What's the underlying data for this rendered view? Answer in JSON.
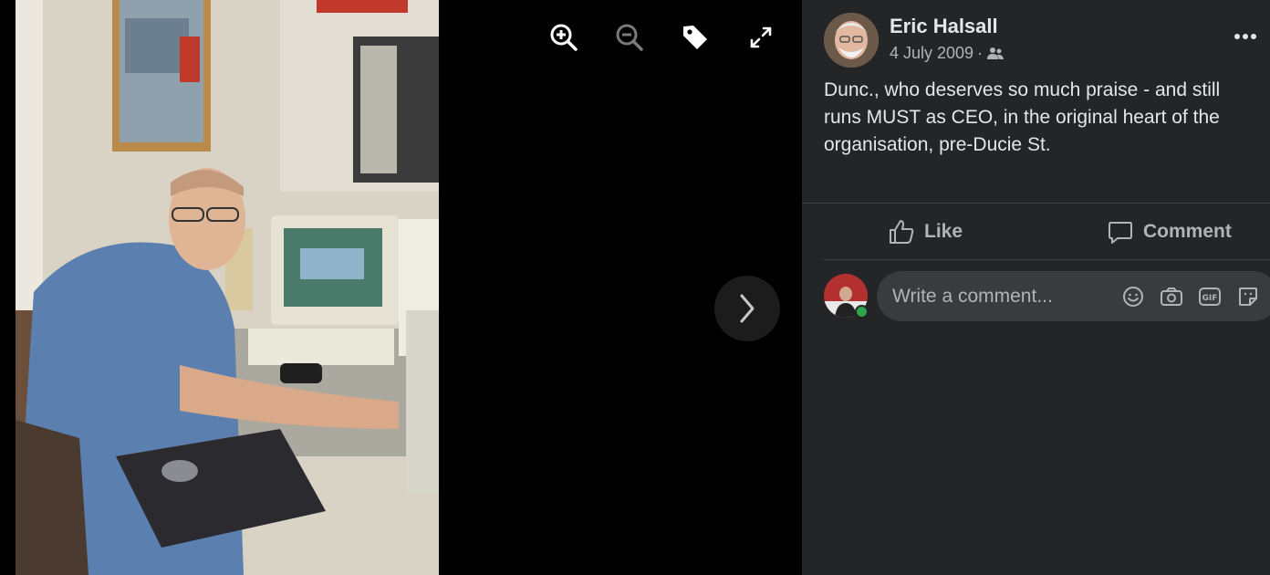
{
  "viewer": {
    "toolbar": {
      "zoom_in": "zoom-in-icon",
      "zoom_out": "zoom-out-icon",
      "tag": "tag-icon",
      "fullscreen": "fullscreen-icon"
    },
    "next": "chevron-right-icon"
  },
  "post": {
    "author": "Eric Halsall",
    "date": "4 July 2009",
    "separator": "·",
    "audience_icon": "friends-icon",
    "caption": "Dunc., who deserves so much praise - and still runs MUST as CEO, in the original heart of the organisation, pre-Ducie St."
  },
  "actions": {
    "like_label": "Like",
    "comment_label": "Comment"
  },
  "comment_input": {
    "placeholder": "Write a comment...",
    "icons": [
      "emoji-icon",
      "camera-icon",
      "gif-icon",
      "sticker-icon"
    ]
  },
  "colors": {
    "panel_bg": "#242526",
    "text_primary": "#e4e6eb",
    "text_secondary": "#b0b3b8",
    "online": "#31a24c"
  }
}
